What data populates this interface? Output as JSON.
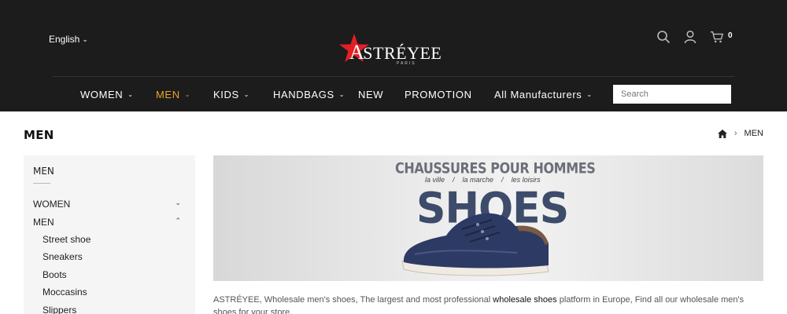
{
  "header": {
    "language": "English",
    "logo": {
      "brand": "STRÉYEE",
      "initial": "A",
      "tagline": "PARIS"
    },
    "cart_count": "0",
    "icons": {
      "search": "search-icon",
      "account": "user-icon",
      "cart": "cart-icon"
    }
  },
  "nav": {
    "items": [
      {
        "label": "WOMEN",
        "has_dropdown": true,
        "active": false
      },
      {
        "label": "MEN",
        "has_dropdown": true,
        "active": true
      },
      {
        "label": "KIDS",
        "has_dropdown": true,
        "active": false
      },
      {
        "label": "HANDBAGS",
        "has_dropdown": true,
        "active": false
      },
      {
        "label": "NEW",
        "has_dropdown": false,
        "active": false
      },
      {
        "label": "PROMOTION",
        "has_dropdown": false,
        "active": false
      },
      {
        "label": "All Manufacturers",
        "has_dropdown": true,
        "active": false
      }
    ],
    "search_placeholder": "Search"
  },
  "page": {
    "title": "MEN",
    "breadcrumb": {
      "home_icon": "home-icon",
      "current": "MEN"
    }
  },
  "sidebar": {
    "title": "MEN",
    "categories": [
      {
        "label": "WOMEN",
        "expanded": false
      },
      {
        "label": "MEN",
        "expanded": true
      }
    ],
    "subcategories": [
      "Street shoe",
      "Sneakers",
      "Boots",
      "Moccasins",
      "Slippers"
    ]
  },
  "banner": {
    "headline": "CHAUSSURES POUR HOMMES",
    "tags": [
      "la ville",
      "/",
      "la marche",
      "/",
      "les loisirs"
    ],
    "big_text": "SHOES"
  },
  "description": {
    "part1": "ASTRÉYEE, Wholesale men's shoes, The largest and most professional ",
    "highlight": "wholesale shoes",
    "part2": " platform in Europe, Find all our wholesale men's shoes for your store."
  },
  "colors": {
    "header_bg": "#1c1c1c",
    "accent": "#e9a62a",
    "logo_star": "#e41e26",
    "sidebar_bg": "#f5f5f5"
  }
}
